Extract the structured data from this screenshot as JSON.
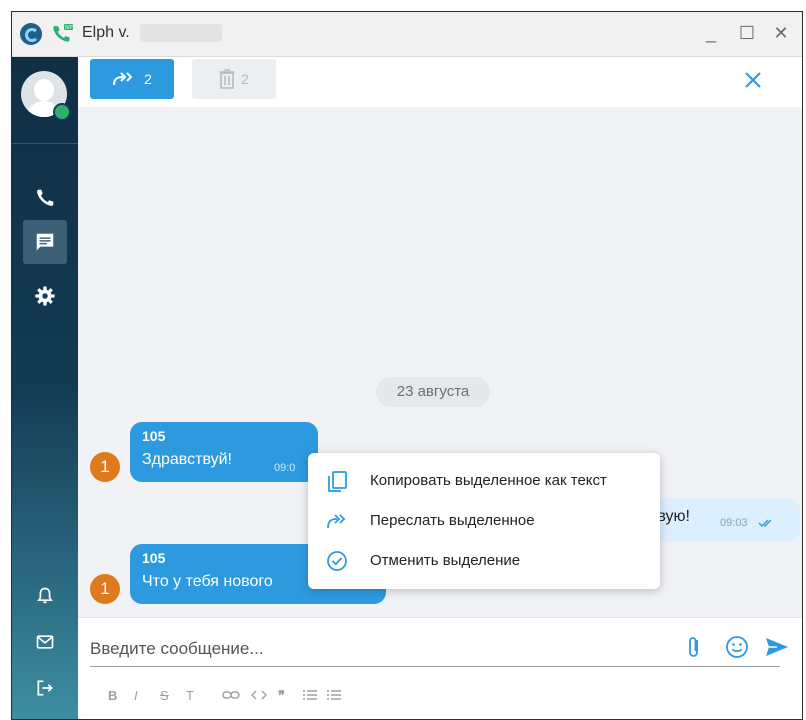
{
  "window": {
    "title": "Elph v.",
    "controls": {
      "minimize": "_",
      "maximize": "☐",
      "close": "✕"
    }
  },
  "sidebar": {
    "items": [
      {
        "icon": "phone-icon"
      },
      {
        "icon": "chat-icon",
        "active": true
      },
      {
        "icon": "gear-icon"
      },
      {
        "icon": "bell-icon"
      },
      {
        "icon": "mail-icon"
      },
      {
        "icon": "logout-icon"
      }
    ]
  },
  "toolbar": {
    "forward_count": "2",
    "delete_count": "2"
  },
  "chat": {
    "date_label": "23 августа",
    "messages": [
      {
        "sender": "105",
        "text": "Здравствуй!",
        "time": "09:0",
        "unread_badge": "1"
      },
      {
        "text": "твую!",
        "time": "09:03"
      },
      {
        "sender": "105",
        "text": "Что у тебя нового",
        "time": "",
        "unread_badge": "1"
      }
    ]
  },
  "context_menu": {
    "items": [
      {
        "icon": "copy-icon",
        "label": "Копировать выделенное как текст"
      },
      {
        "icon": "forward-icon",
        "label": "Переслать выделенное"
      },
      {
        "icon": "check-circle-icon",
        "label": "Отменить выделение"
      }
    ]
  },
  "composer": {
    "placeholder": "Введите сообщение...",
    "format_buttons": [
      "B",
      "I",
      "S",
      "T",
      "link",
      "code",
      "quote",
      "bulleted-list",
      "numbered-list"
    ]
  },
  "colors": {
    "accent": "#2d9ae0",
    "badge": "#e07a1f",
    "online": "#2fae72"
  }
}
